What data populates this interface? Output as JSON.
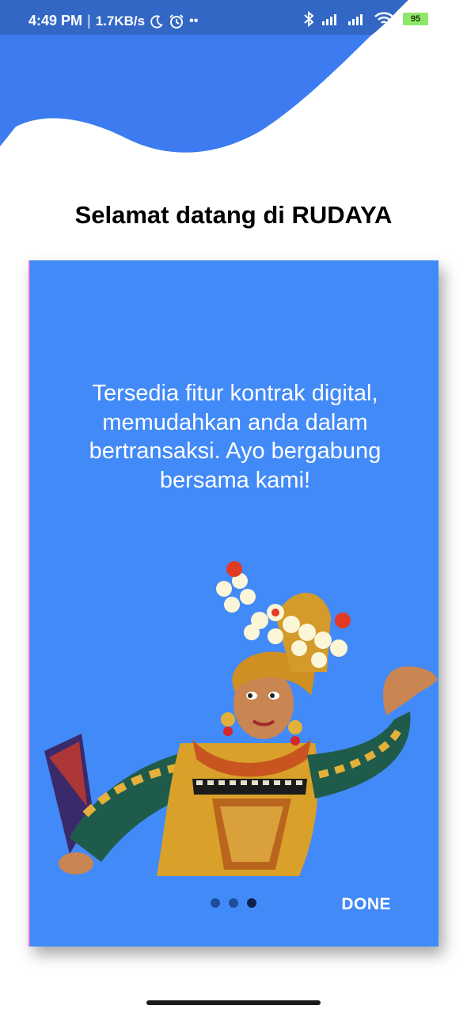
{
  "status_bar": {
    "time": "4:49 PM",
    "network_speed": "1.7KB/s",
    "battery_level": "95",
    "icons": [
      "moon-icon",
      "alarm-icon",
      "bluetooth-icon",
      "signal-icon",
      "signal-icon",
      "wifi-icon",
      "battery-icon",
      "charging-icon"
    ]
  },
  "header": {
    "title": "Selamat datang di RUDAYA"
  },
  "slide": {
    "text": "Tersedia fitur kontrak digital, memudahkan anda dalam bertransaksi. Ayo bergabung bersama kami!",
    "image": "balinese-dancer-image",
    "page_count": 3,
    "current_page": 3
  },
  "footer": {
    "done_label": "DONE"
  },
  "colors": {
    "primary": "#428AF7",
    "header_blue": "#3C7CF0",
    "status_bar_blue": "#3367C6",
    "white": "#FFFFFF"
  }
}
